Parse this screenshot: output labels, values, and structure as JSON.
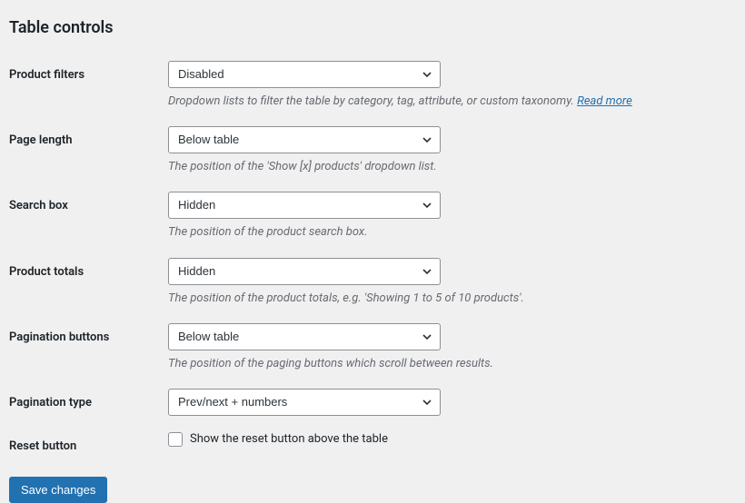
{
  "section_title": "Table controls",
  "fields": {
    "product_filters": {
      "label": "Product filters",
      "value": "Disabled",
      "desc_prefix": "Dropdown lists to filter the table by category, tag, attribute, or custom taxonomy. ",
      "read_more": "Read more"
    },
    "page_length": {
      "label": "Page length",
      "value": "Below table",
      "desc": "The position of the 'Show [x] products' dropdown list."
    },
    "search_box": {
      "label": "Search box",
      "value": "Hidden",
      "desc": "The position of the product search box."
    },
    "product_totals": {
      "label": "Product totals",
      "value": "Hidden",
      "desc": "The position of the product totals, e.g. 'Showing 1 to 5 of 10 products'."
    },
    "pagination_buttons": {
      "label": "Pagination buttons",
      "value": "Below table",
      "desc": "The position of the paging buttons which scroll between results."
    },
    "pagination_type": {
      "label": "Pagination type",
      "value": "Prev/next + numbers"
    },
    "reset_button": {
      "label": "Reset button",
      "checkbox_label": "Show the reset button above the table"
    }
  },
  "save_button": "Save changes"
}
